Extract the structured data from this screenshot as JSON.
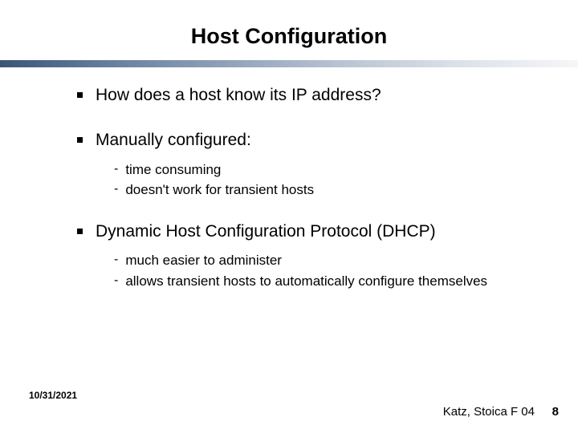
{
  "title": "Host Configuration",
  "bullets": [
    {
      "text": "How does a host know its IP address?",
      "subs": []
    },
    {
      "text": "Manually configured:",
      "subs": [
        "time consuming",
        "doesn't work for transient hosts"
      ]
    },
    {
      "text": "Dynamic Host Configuration Protocol (DHCP)",
      "subs": [
        "much easier to administer",
        "allows transient hosts to automatically configure themselves"
      ]
    }
  ],
  "footer": {
    "date": "10/31/2021",
    "credit": "Katz, Stoica F 04",
    "page": "8"
  }
}
